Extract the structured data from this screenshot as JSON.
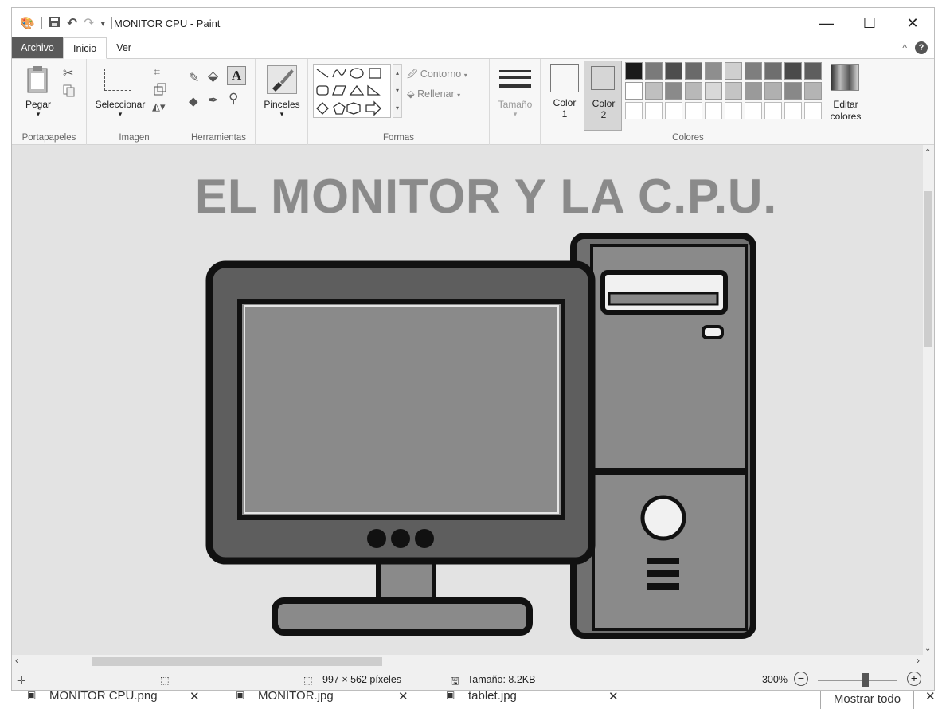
{
  "window": {
    "title": "MONITOR CPU - Paint",
    "controls": {
      "minimize": "—",
      "maximize": "☐",
      "close": "✕"
    }
  },
  "tabs": [
    {
      "label": "Archivo"
    },
    {
      "label": "Inicio"
    },
    {
      "label": "Ver"
    }
  ],
  "ribbon": {
    "portapapeles": {
      "paste": "Pegar",
      "group": "Portapapeles"
    },
    "imagen": {
      "select": "Seleccionar",
      "group": "Imagen"
    },
    "herramientas": {
      "group": "Herramientas"
    },
    "pinceles": {
      "label": "Pinceles"
    },
    "formas": {
      "outline": "Contorno",
      "fill": "Rellenar",
      "group": "Formas"
    },
    "tamano": {
      "label": "Tamaño"
    },
    "colores": {
      "color1": "Color",
      "color1_num": "1",
      "color2": "Color",
      "color2_num": "2",
      "edit": "Editar colores",
      "group": "Colores"
    },
    "palette_row1": [
      "#1a1a1a",
      "#7a7a7a",
      "#4d4d4d",
      "#6a6a6a",
      "#8e8e8e",
      "#cfcfcf",
      "#7e7e7e",
      "#6e6e6e",
      "#4a4a4a",
      "#5e5e5e"
    ],
    "palette_row2": [
      "#ffffff",
      "#bfbfbf",
      "#8a8a8a",
      "#b8b8b8",
      "#d8d8d8",
      "#c4c4c4",
      "#9a9a9a",
      "#b0b0b0",
      "#888888",
      "#b4b4b4"
    ],
    "color1_value": "#8e8e8e",
    "color2_value": "#ffffff"
  },
  "canvas": {
    "heading": "EL MONITOR Y LA C.P.U."
  },
  "status": {
    "dimensions": "997 × 562 píxeles",
    "size": "Tamaño: 8.2KB",
    "zoom": "300%"
  },
  "taskbar": {
    "files": [
      "MONITOR CPU.png",
      "MONITOR.jpg",
      "tablet.jpg"
    ],
    "show_all": "Mostrar todo"
  }
}
